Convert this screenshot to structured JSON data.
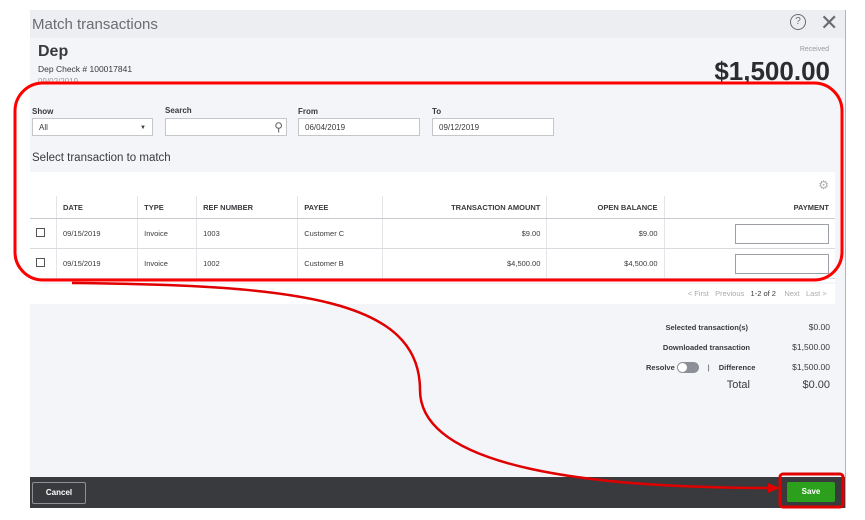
{
  "title": "Match transactions",
  "header": {
    "name": "Dep",
    "check": "Dep Check # 100017841",
    "date": "09/02/2019",
    "received_label": "Received",
    "amount": "$1,500.00"
  },
  "filters": {
    "show_label": "Show",
    "show_value": "All",
    "search_label": "Search",
    "search_value": "",
    "from_label": "From",
    "from_value": "06/04/2019",
    "to_label": "To",
    "to_value": "09/12/2019"
  },
  "section_title": "Select transaction to match",
  "table": {
    "columns": [
      "DATE",
      "TYPE",
      "REF NUMBER",
      "PAYEE",
      "TRANSACTION AMOUNT",
      "OPEN BALANCE",
      "PAYMENT"
    ],
    "rows": [
      {
        "date": "09/15/2019",
        "type": "Invoice",
        "ref": "1003",
        "payee": "Customer C",
        "amount": "$9.00",
        "balance": "$9.00",
        "payment": ""
      },
      {
        "date": "09/15/2019",
        "type": "Invoice",
        "ref": "1002",
        "payee": "Customer B",
        "amount": "$4,500.00",
        "balance": "$4,500.00",
        "payment": ""
      }
    ]
  },
  "pagination": {
    "first": "< First",
    "previous": "Previous",
    "range": "1-2 of 2",
    "next": "Next",
    "last": "Last >"
  },
  "summary": {
    "selected_label": "Selected transaction(s)",
    "selected_value": "$0.00",
    "downloaded_label": "Downloaded transaction",
    "downloaded_value": "$1,500.00",
    "resolve_label": "Resolve",
    "resolve_on": false,
    "separator": "|",
    "difference_label": "Difference",
    "difference_value": "$1,500.00",
    "total_label": "Total",
    "total_value": "$0.00"
  },
  "footer": {
    "cancel": "Cancel",
    "save": "Save"
  },
  "colors": {
    "save": "#2ca01c",
    "annotation": "#ff0000",
    "footer": "#393a3d"
  }
}
